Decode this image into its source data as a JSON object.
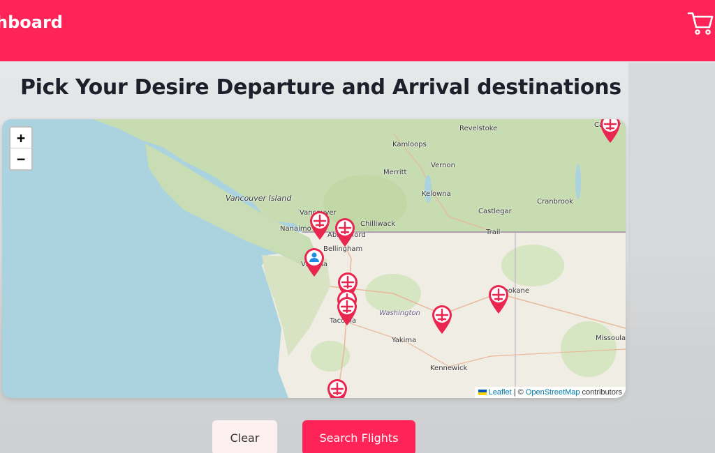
{
  "header": {
    "brand": "hboard",
    "cart_icon": "cart-icon",
    "color": "#ff2457"
  },
  "page": {
    "heading": "Pick Your Desire Departure and Arrival destinations"
  },
  "map": {
    "zoom_in": "+",
    "zoom_out": "−",
    "labels": {
      "vancouver_island": "Vancouver Island",
      "revelstoke": "Revelstoke",
      "kamloops": "Kamloops",
      "vernon": "Vernon",
      "merritt": "Merritt",
      "kelowna": "Kelowna",
      "castlegar": "Castlegar",
      "trail": "Trail",
      "cranbrook": "Cranbrook",
      "nanaimo": "Nanaimo",
      "vancouver": "Vancouver",
      "abbotsford": "Abbotsford",
      "chilliwack": "Chilliwack",
      "bellingham": "Bellingham",
      "victoria": "Victoria",
      "tacoma": "Tacoma",
      "washington": "Washington",
      "yakima": "Yakima",
      "kennewick": "Kennewick",
      "spokane": "Spokane",
      "missoula": "Missoula",
      "calgary": "Calgary"
    },
    "attribution": {
      "leaflet": "Leaflet",
      "separator": " | © ",
      "osm": "OpenStreetMap",
      "contributors": " contributors"
    },
    "marker_color": "#e8264f",
    "user_marker_color": "#1e88e5"
  },
  "actions": {
    "clear": "Clear",
    "search": "Search Flights"
  }
}
